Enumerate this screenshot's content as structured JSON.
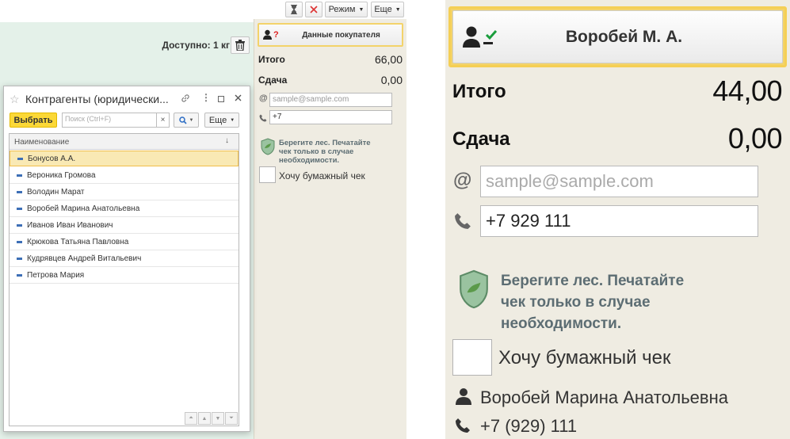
{
  "toolbar": {
    "mode_label": "Режим",
    "more_label": "Еще"
  },
  "main": {
    "available": "Доступно: 1 кг"
  },
  "customer_panel": {
    "buyer_button": "Данные покупателя",
    "total_label": "Итого",
    "total_value": "66,00",
    "change_label": "Сдача",
    "change_value": "0,00",
    "email_placeholder": "sample@sample.com",
    "phone_value": "+7",
    "eco_message": "Берегите лес. Печатайте чек только в случае необходимости.",
    "paper_receipt_label": "Хочу бумажный чек"
  },
  "dialog": {
    "title": "Контрагенты (юридически...",
    "select_button": "Выбрать",
    "search_placeholder": "Поиск (Ctrl+F)",
    "more_label": "Еще",
    "column_header": "Наименование",
    "rows": [
      "Бонусов А.А.",
      "Вероника Громова",
      "Володин Марат",
      "Воробей Марина Анатольевна",
      "Иванов Иван Иванович",
      "Крюкова Татьяна Павловна",
      "Кудрявцев Андрей Витальевич",
      "Петрова Мария"
    ],
    "selected_index": 0
  },
  "zoomed_panel": {
    "buyer_button": "Воробей М. А.",
    "total_label": "Итого",
    "total_value": "44,00",
    "change_label": "Сдача",
    "change_value": "0,00",
    "email_placeholder": "sample@sample.com",
    "phone_value": "+7 929 111",
    "eco_line1": "Берегите лес. Печатайте",
    "eco_line2": "чек только в случае",
    "eco_line3": "необходимости.",
    "paper_receipt_label": "Хочу бумажный чек",
    "customer_name": "Воробей Марина Анатольевна",
    "customer_phone": "+7 (929) 111"
  },
  "colors": {
    "accent_yellow": "#fbd837",
    "selection_border": "#f0be4a",
    "panel_bg": "#efece2",
    "green_bg": "#e4f1e9"
  }
}
